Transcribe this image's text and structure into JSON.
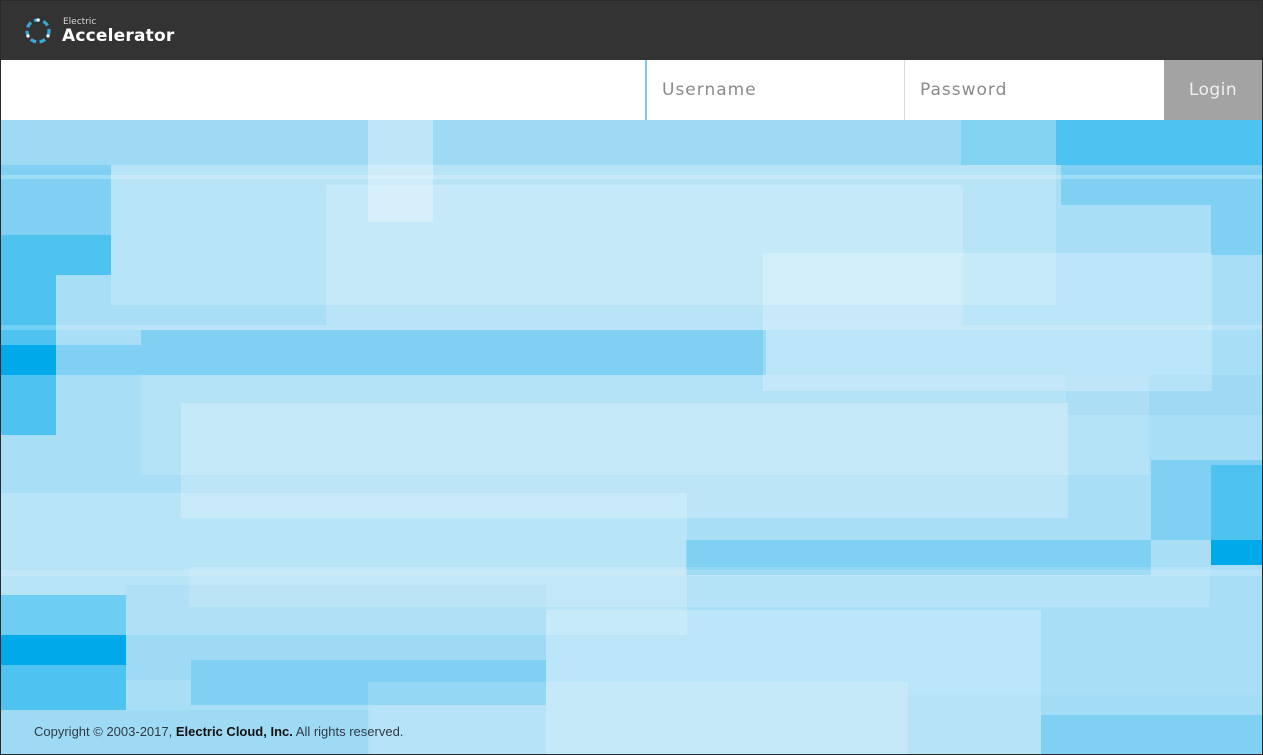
{
  "header": {
    "brand_small": "Electric",
    "brand_large": "Accelerator"
  },
  "login": {
    "username_placeholder": "Username",
    "password_placeholder": "Password",
    "button_label": "Login"
  },
  "footer": {
    "prefix": "Copyright © 2003-2017, ",
    "company": "Electric Cloud, Inc.",
    "suffix": " All rights reserved."
  },
  "colors": {
    "topbar": "#333333",
    "login_button": "#a3a3a3",
    "hero_base": "#a8def6",
    "logo_accent": "#3aa6d8"
  }
}
